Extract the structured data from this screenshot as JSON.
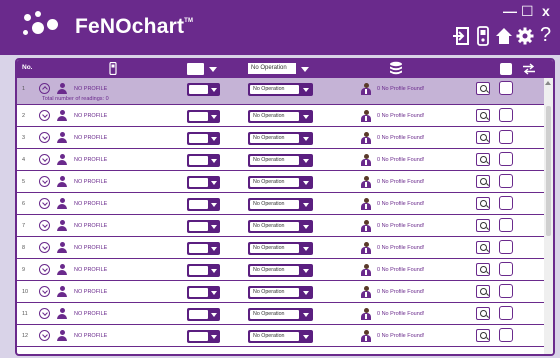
{
  "app": {
    "logo_text": "FeNOchart",
    "trademark": "TM"
  },
  "window_controls": {
    "minimize": "—",
    "maximize": "☐",
    "close": "x"
  },
  "toolbar_icons": [
    "logout-icon",
    "device-icon",
    "home-icon",
    "gear-icon",
    "help-icon"
  ],
  "help_glyph": "?",
  "table": {
    "header_no": "No.",
    "header_operation": "No Operation",
    "readings_label": "Total number of readings: 0",
    "rows": [
      {
        "num": "1",
        "name": "NO PROFILE",
        "op": "No Operation",
        "status": "0 No Profile Found!"
      },
      {
        "num": "2",
        "name": "NO PROFILE",
        "op": "No Operation",
        "status": "0 No Profile Found!"
      },
      {
        "num": "3",
        "name": "NO PROFILE",
        "op": "No Operation",
        "status": "0 No Profile Found!"
      },
      {
        "num": "4",
        "name": "NO PROFILE",
        "op": "No Operation",
        "status": "0 No Profile Found!"
      },
      {
        "num": "5",
        "name": "NO PROFILE",
        "op": "No Operation",
        "status": "0 No Profile Found!"
      },
      {
        "num": "6",
        "name": "NO PROFILE",
        "op": "No Operation",
        "status": "0 No Profile Found!"
      },
      {
        "num": "7",
        "name": "NO PROFILE",
        "op": "No Operation",
        "status": "0 No Profile Found!"
      },
      {
        "num": "8",
        "name": "NO PROFILE",
        "op": "No Operation",
        "status": "0 No Profile Found!"
      },
      {
        "num": "9",
        "name": "NO PROFILE",
        "op": "No Operation",
        "status": "0 No Profile Found!"
      },
      {
        "num": "10",
        "name": "NO PROFILE",
        "op": "No Operation",
        "status": "0 No Profile Found!"
      },
      {
        "num": "11",
        "name": "NO PROFILE",
        "op": "No Operation",
        "status": "0 No Profile Found!"
      },
      {
        "num": "12",
        "name": "NO PROFILE",
        "op": "No Operation",
        "status": "0 No Profile Found!"
      }
    ]
  },
  "colors": {
    "brand": "#6a2a8c",
    "selected_row": "#c5b3d6",
    "background": "#d9d3e8"
  }
}
